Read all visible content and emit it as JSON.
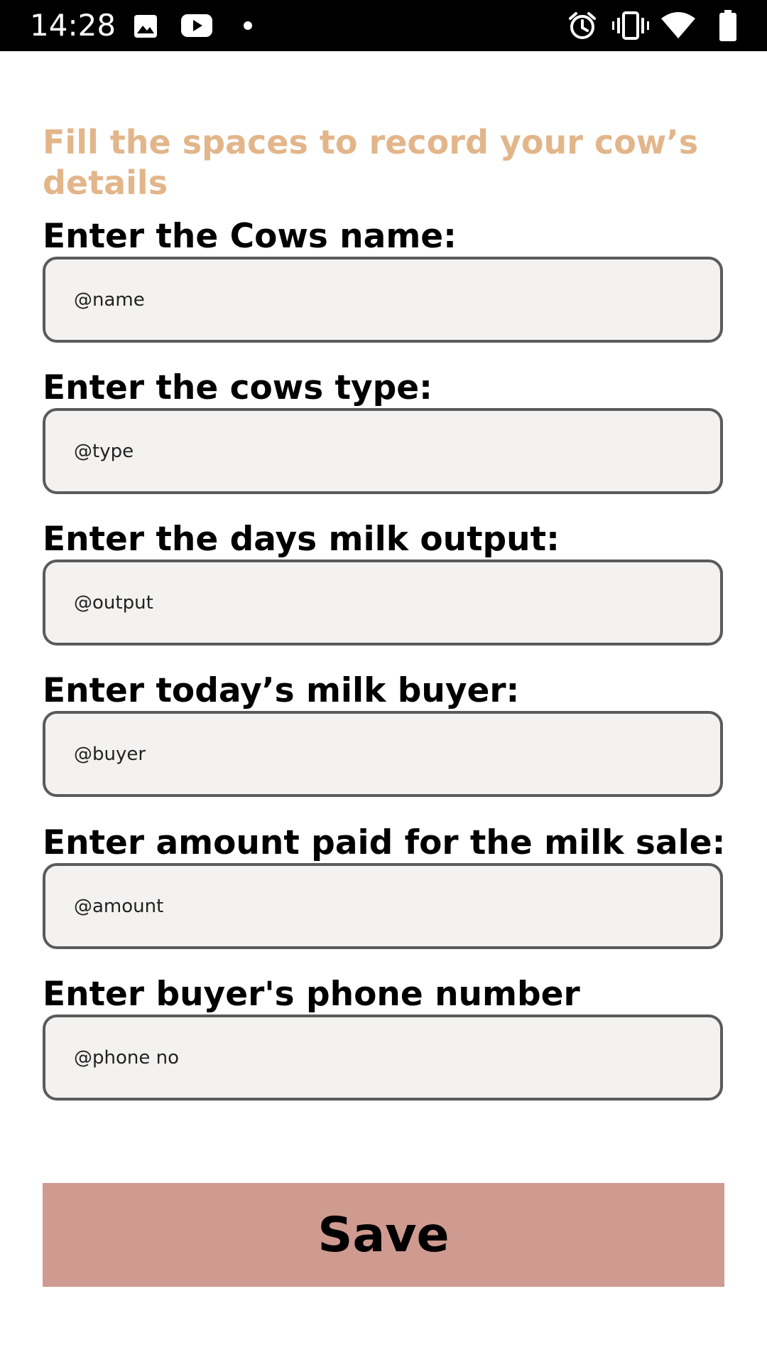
{
  "status_bar": {
    "time": "14:28",
    "left_icons": [
      "image-icon",
      "youtube-icon",
      "notification-dot-icon"
    ],
    "right_icons": [
      "alarm-icon",
      "vibrate-icon",
      "wifi-icon",
      "battery-icon"
    ]
  },
  "form": {
    "heading": "Fill the spaces to record your cow’s details",
    "fields": [
      {
        "label": "Enter the Cows name:",
        "placeholder": "@name"
      },
      {
        "label": "Enter the cows type:",
        "placeholder": "@type"
      },
      {
        "label": "Enter the days milk output:",
        "placeholder": "@output"
      },
      {
        "label": "Enter today’s milk buyer:",
        "placeholder": "@buyer"
      },
      {
        "label": "Enter amount paid for the milk sale:",
        "placeholder": "@amount"
      },
      {
        "label": "Enter buyer's phone number",
        "placeholder": "@phone no"
      }
    ],
    "save_label": "Save"
  },
  "colors": {
    "heading": "#e2b68a",
    "field_bg": "#f3f2f1",
    "field_border": "#5b5b5b",
    "save_button": "#cf9a8f",
    "status_bar": "#000000"
  }
}
